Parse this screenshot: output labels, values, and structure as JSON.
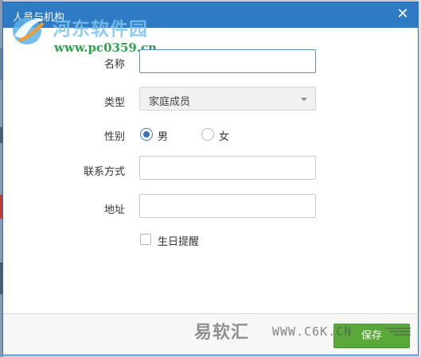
{
  "dialog": {
    "title": "人员与机构",
    "close_glyph": "✕"
  },
  "watermark": {
    "site_name": "河东软件园",
    "site_url": "www.pc0359.cn",
    "brand2": "易软汇",
    "brand2_url": "WWW.C6K.CN"
  },
  "form": {
    "name": {
      "label": "名称",
      "value": ""
    },
    "type": {
      "label": "类型",
      "selected": "家庭成员"
    },
    "gender": {
      "label": "性别",
      "options": [
        {
          "label": "男",
          "checked": true
        },
        {
          "label": "女",
          "checked": false
        }
      ]
    },
    "contact": {
      "label": "联系方式",
      "value": ""
    },
    "address": {
      "label": "地址",
      "value": ""
    },
    "birthday_reminder": {
      "label": "生日提醒",
      "checked": false
    }
  },
  "footer": {
    "save_label": "保存"
  },
  "colors": {
    "title_bar": "#2f7ac4",
    "save_button": "#5aa83a",
    "radio_checked": "#3a72b2"
  }
}
